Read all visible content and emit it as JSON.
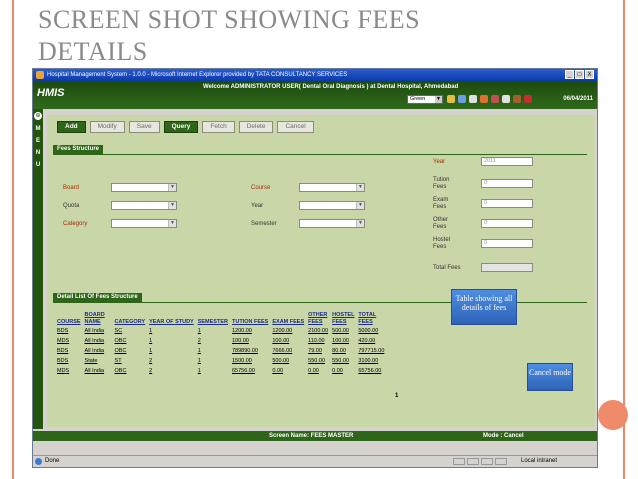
{
  "slide": {
    "title_line1": "SCREEN SHOT SHOWING FEES",
    "title_line2": "DETAILS"
  },
  "browser": {
    "title": "Hospital Management System - 1.0.0 - Microsoft Internet Explorer provided by TATA CONSULTANCY SERVICES",
    "window_buttons": [
      "_",
      "□",
      "X"
    ],
    "status": "Done",
    "zone": "Local intranet"
  },
  "app": {
    "logo": "HMIS",
    "welcome": "Welcome  ADMINISTRATOR USER( Dental Oral Diagnosis )  at  Dental Hospital, Ahmedabad",
    "theme": "Green",
    "date": "06/04/2011",
    "side_menu_letters": [
      "M",
      "E",
      "N",
      "U"
    ]
  },
  "toolbar": {
    "add": "Add",
    "modify": "Modify",
    "save": "Save",
    "query": "Query",
    "fetch": "Fetch",
    "delete": "Delete",
    "cancel": "Cancel"
  },
  "form": {
    "section": "Fees Structure",
    "board": "Board",
    "quota": "Quota",
    "category": "Category",
    "course": "Course",
    "year": "Year",
    "semester": "Semester",
    "right_year": "Year",
    "right_year_value": "2011",
    "tuition_fees": "Tution Fees",
    "exam_fees": "Exam Fees",
    "other_fees": "Other Fees",
    "hostel_fees": "Hostel Fees",
    "total_fees": "Total Fees",
    "zero": "0"
  },
  "list": {
    "section": "Detail List Of Fees Structure",
    "headers": [
      "COURSE",
      "BOARD NAME",
      "CATEGORY",
      "YEAR OF STUDY",
      "SEMESTER",
      "TUTION FEES",
      "EXAM FEES",
      "OTHER FEES",
      "HOSTEL FEES",
      "TOTAL FEES"
    ],
    "rows": [
      [
        "BDS",
        "All India",
        "SC",
        "1",
        "1",
        "1200.00",
        "1200.00",
        "2100.00",
        "500.00",
        "5000.00"
      ],
      [
        "MDS",
        "All India",
        "OBC",
        "1",
        "2",
        "100.00",
        "100.00",
        "110.00",
        "100.00",
        "420.00"
      ],
      [
        "BDS",
        "All India",
        "OBC",
        "1",
        "1",
        "789890.00",
        "7666.00",
        "79.00",
        "80.00",
        "797715.00"
      ],
      [
        "BDS",
        "State",
        "ST",
        "2",
        "1",
        "1500.00",
        "500.00",
        "550.00",
        "550.00",
        "3100.00"
      ],
      [
        "MDS",
        "All India",
        "OBC",
        "2",
        "1",
        "65756.00",
        "0.00",
        "0.00",
        "0.00",
        "65756.00"
      ]
    ],
    "page": "1"
  },
  "callouts": {
    "table": "Table showing all details of fees",
    "cancel": "Cancel mode"
  },
  "footer": {
    "screen_name": "Screen Name: FEES MASTER",
    "mode": "Mode : Cancel"
  },
  "colors": {
    "header_green": "#2f6a1a",
    "panel": "#c9d7a8",
    "accent": "#ef8a6a",
    "callout_blue": "#3c78d0"
  }
}
